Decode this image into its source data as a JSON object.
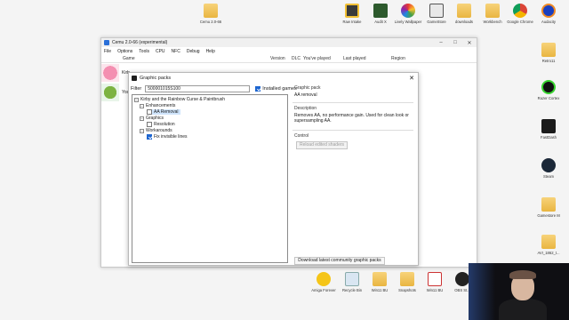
{
  "desktop_icons": {
    "cemu_folder": "Cemu 2.0-66",
    "raw_intake": "Raw Intake",
    "audit_x": "Audit X",
    "lively": "Lively Wallpaper",
    "gamestore": "GameStore",
    "downloads": "downloads",
    "workbench": "Workbench",
    "chrome": "Google Chrome",
    "audacity": "Audacity",
    "retro": "Retro11",
    "razer": "Razer Cortex",
    "lasttext": "FastDash",
    "steam": "Steam",
    "gamestore_m": "Gamestore M",
    "avi": "AVI_1862_t...",
    "amiga": "Amiga Forever",
    "recycle": "Recycle Bin",
    "winbu": "Win11 BU",
    "snapshots": "Snapshots",
    "winbu2": "Win11 BU",
    "obs": "OBS St..."
  },
  "cemu": {
    "title": "Cemu 2.0-66 (experimental)",
    "menu": [
      "File",
      "Options",
      "Tools",
      "CPU",
      "NFC",
      "Debug",
      "Help"
    ],
    "columns": [
      "Game",
      "Version",
      "DLC",
      "You've played",
      "Last played",
      "Region"
    ],
    "rows": [
      "Kirb",
      "Yos"
    ]
  },
  "dialog": {
    "title": "Graphic packs",
    "filter_label": "Filter",
    "filter_value": "500001015S100",
    "installed_games_label": "Installed games",
    "tree": {
      "root": "Kirby and the Rainbow Curse & Paintbrush",
      "groups": [
        {
          "label": "Enhancements",
          "items": [
            {
              "label": "AA Removal",
              "checked": false
            }
          ]
        },
        {
          "label": "Graphics",
          "items": [
            {
              "label": "Resolution",
              "checked": false
            }
          ]
        },
        {
          "label": "Workarounds",
          "items": [
            {
              "label": "Fix invisible lines",
              "checked": true
            }
          ]
        }
      ]
    },
    "graphic_pack_label": "Graphic pack",
    "graphic_pack_value": "AA removal",
    "description_label": "Description",
    "description_value": "Removes AA, no performance gain. Used for clean look or supersampling AA.",
    "control_label": "Control",
    "reload_button": "Reload edited shaders",
    "download_button": "Download latest community graphic packs"
  },
  "colors": {
    "accent": "#1e66d0",
    "selection": "#cfe4fb"
  }
}
